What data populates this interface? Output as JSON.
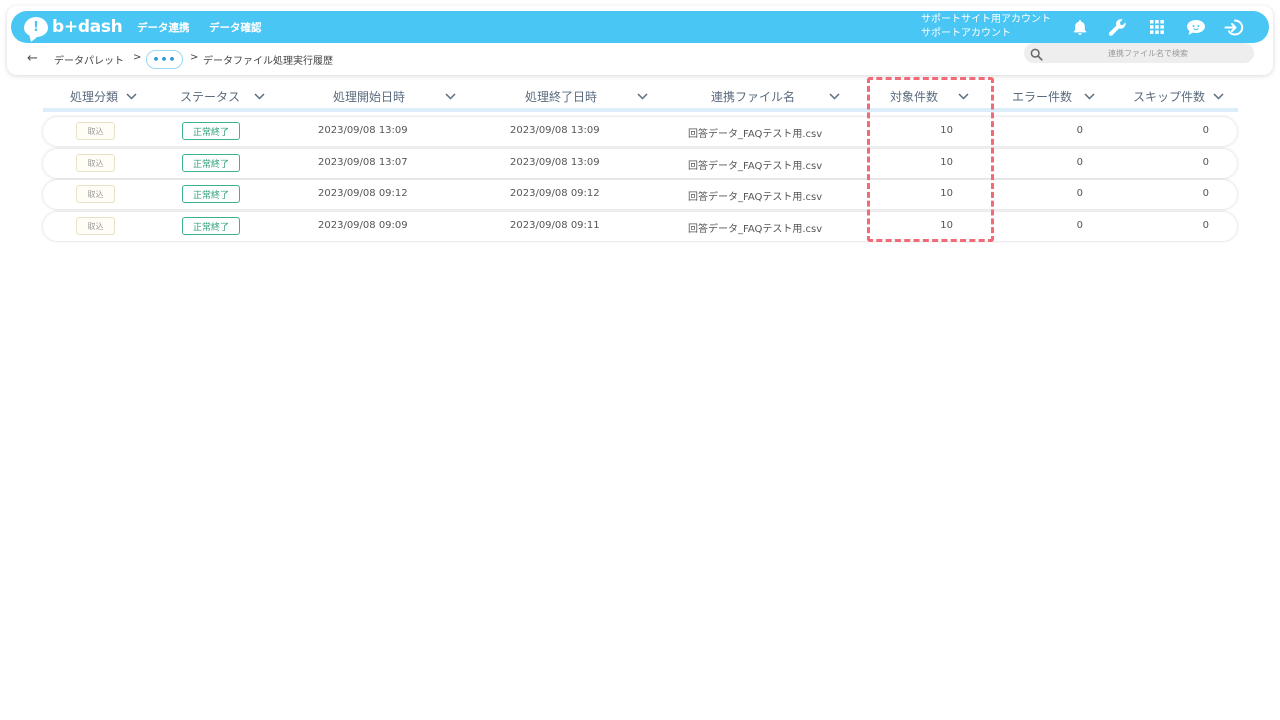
{
  "header": {
    "logo_text": "b+dash",
    "nav": [
      "データ連携",
      "データ確認"
    ],
    "account_line1": "サポートサイト用アカウント",
    "account_line2": "サポートアカウント",
    "icons": [
      "bell-icon",
      "wrench-icon",
      "grid-icon",
      "chat-face-icon",
      "logout-icon"
    ],
    "accent_color": "#4ac6f5"
  },
  "breadcrumb": {
    "back_icon": "←",
    "items": [
      "データパレット",
      "データファイル処理実行履歴"
    ],
    "separator": ">",
    "more_label": "•••"
  },
  "search": {
    "placeholder": "連携ファイル名で検索"
  },
  "table": {
    "columns": [
      "処理分類",
      "ステータス",
      "処理開始日時",
      "処理終了日時",
      "連携ファイル名",
      "対象件数",
      "エラー件数",
      "スキップ件数"
    ],
    "rows": [
      {
        "type": "取込",
        "status": "正常終了",
        "start": "2023/09/08 13:09",
        "end": "2023/09/08 13:09",
        "file": "回答データ_FAQテスト用.csv",
        "target": "10",
        "errors": "0",
        "skipped": "0"
      },
      {
        "type": "取込",
        "status": "正常終了",
        "start": "2023/09/08 13:07",
        "end": "2023/09/08 13:09",
        "file": "回答データ_FAQテスト用.csv",
        "target": "10",
        "errors": "0",
        "skipped": "0"
      },
      {
        "type": "取込",
        "status": "正常終了",
        "start": "2023/09/08 09:12",
        "end": "2023/09/08 09:12",
        "file": "回答データ_FAQテスト用.csv",
        "target": "10",
        "errors": "0",
        "skipped": "0"
      },
      {
        "type": "取込",
        "status": "正常終了",
        "start": "2023/09/08 09:09",
        "end": "2023/09/08 09:11",
        "file": "回答データ_FAQテスト用.csv",
        "target": "10",
        "errors": "0",
        "skipped": "0"
      }
    ],
    "status_color": "#3db38b",
    "highlight_color": "#f06a78"
  }
}
